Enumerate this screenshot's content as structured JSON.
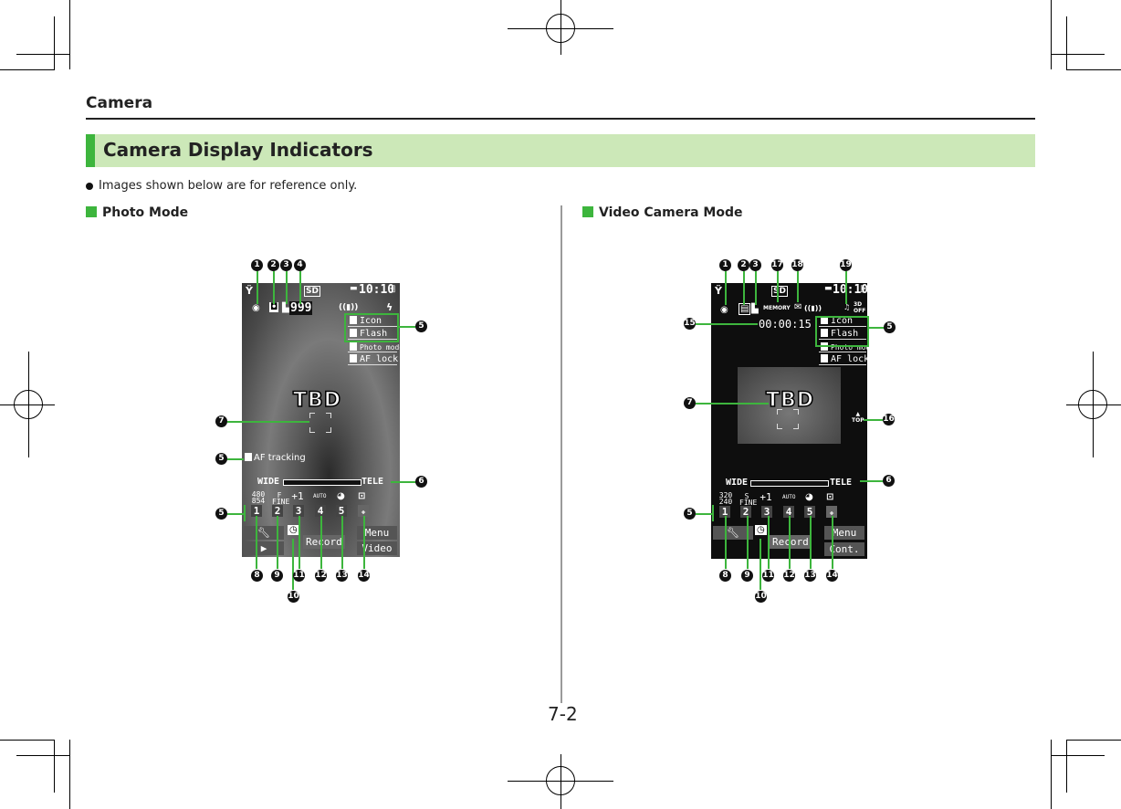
{
  "header": {
    "chapter": "Camera"
  },
  "section": {
    "title": "Camera Display Indicators"
  },
  "note": "Images shown below are for reference only.",
  "page_number": "7-2",
  "colors": {
    "accent_green": "#3db53d",
    "section_bg": "#cce8b8"
  },
  "photo_mode": {
    "heading": "Photo Mode",
    "screen": {
      "clock": "10:10",
      "shots_remaining": "999",
      "menu_items": [
        "Icon",
        "Flash",
        "Photo mode",
        "AF lock"
      ],
      "image_placeholder": "TBD",
      "af_tracking_label": "AF tracking",
      "zoom_wide": "WIDE",
      "zoom_tele": "TELE",
      "setting_values": [
        "480 854",
        "F FINE",
        "+1",
        "AUTO",
        "",
        ""
      ],
      "setting_numbers": [
        "1",
        "2",
        "3",
        "4",
        "5",
        ""
      ],
      "softkeys": {
        "left_top": "settings-icon",
        "left_bottom": "play-icon",
        "center": "Record",
        "right_top": "Menu",
        "right_bottom": "Video"
      }
    },
    "callouts": [
      "1",
      "2",
      "3",
      "4",
      "5",
      "5",
      "5",
      "6",
      "7",
      "8",
      "9",
      "10",
      "11",
      "12",
      "13",
      "14"
    ]
  },
  "video_mode": {
    "heading": "Video Camera Mode",
    "screen": {
      "clock": "10:10",
      "memory_label": "MEMORY",
      "rec_time": "00:00:15",
      "menu_items": [
        "Icon",
        "Flash",
        "Photo mode",
        "AF lock"
      ],
      "image_placeholder": "TBD",
      "top_label": "TOP",
      "zoom_wide": "WIDE",
      "zoom_tele": "TELE",
      "setting_values": [
        "320 240",
        "S FINE",
        "+1",
        "AUTO",
        "",
        ""
      ],
      "setting_numbers": [
        "1",
        "2",
        "3",
        "4",
        "5",
        ""
      ],
      "softkeys": {
        "left_top": "settings-icon",
        "center": "Record",
        "right_top": "Menu",
        "right_bottom": "Cont."
      }
    },
    "callouts": [
      "1",
      "2",
      "3",
      "17",
      "18",
      "19",
      "15",
      "5",
      "7",
      "16",
      "6",
      "5",
      "8",
      "9",
      "10",
      "11",
      "12",
      "13",
      "14"
    ]
  }
}
